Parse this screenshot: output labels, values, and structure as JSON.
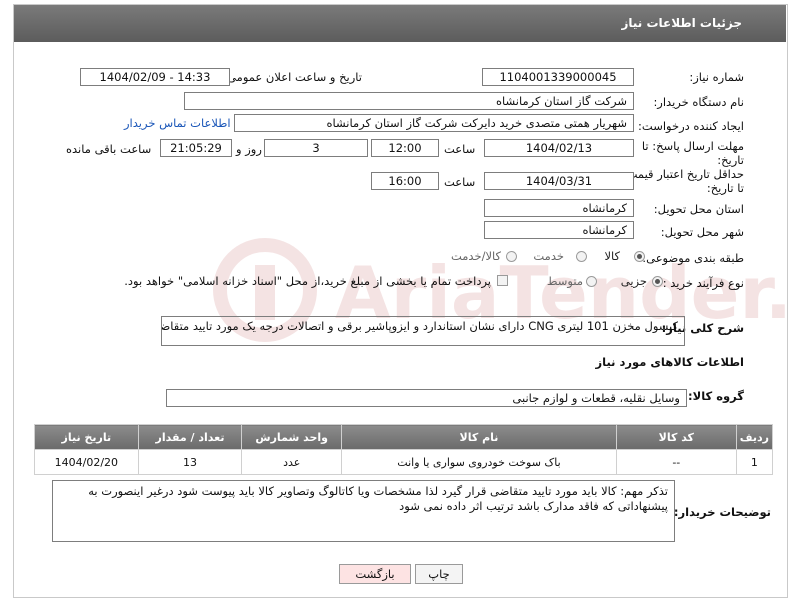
{
  "header": {
    "title": "جزئیات اطلاعات نیاز"
  },
  "fields": {
    "need_number_label": "شماره نیاز:",
    "need_number": "1104001339000045",
    "announce_label": "تاریخ و ساعت اعلان عمومی:",
    "announce_value": "1404/02/09 - 14:33",
    "buyer_org_label": "نام دستگاه خریدار:",
    "buyer_org": "شرکت گاز استان کرمانشاه",
    "creator_label": "ایجاد کننده درخواست:",
    "creator": "شهریار همتی متصدی خرید دایرکت شرکت گاز استان کرمانشاه",
    "contact_link": "اطلاعات تماس خریدار",
    "deadline_label_1": "مهلت ارسال پاسخ: تا",
    "deadline_label_2": "تاریخ:",
    "deadline_date": "1404/02/13",
    "time_label": "ساعت",
    "deadline_time": "12:00",
    "days_value": "3",
    "days_label": "روز و",
    "remaining_time": "21:05:29",
    "remaining_label": "ساعت باقی مانده",
    "validity_label_1": "حداقل تاریخ اعتبار قیمت:",
    "validity_label_2": "تا تاریخ:",
    "validity_date": "1404/03/31",
    "validity_time": "16:00",
    "province_label": "استان محل تحویل:",
    "province": "کرمانشاه",
    "city_label": "شهر محل تحویل:",
    "city": "کرمانشاه",
    "category_label": "طبقه بندی موضوعی:",
    "category_options": [
      "کالا",
      "خدمت",
      "کالا/خدمت"
    ],
    "process_label": "نوع فرآیند خرید :",
    "process_options": [
      "جزیی",
      "متوسط"
    ],
    "payment_note": "پرداخت تمام یا بخشی از مبلغ خرید،از محل \"اسناد خزانه اسلامی\" خواهد بود.",
    "description_label": "شرح کلی نیاز:",
    "description": "کپسول مخزن 101 لیتری CNG دارای نشان استاندارد و ایزوپاشیر برقی و اتصالات درجه یک مورد تایید متقاضی",
    "goods_info_title": "اطلاعات کالاهای مورد نیاز",
    "goods_group_label": "گروه کالا:",
    "goods_group": "وسایل نقلیه، قطعات و لوازم جانبی"
  },
  "table": {
    "headers": [
      "ردیف",
      "کد کالا",
      "نام کالا",
      "واحد شمارش",
      "تعداد / مقدار",
      "تاریخ نیاز"
    ],
    "rows": [
      [
        "1",
        "--",
        "باک سوخت خودروی سواری یا وانت",
        "عدد",
        "13",
        "1404/02/20"
      ]
    ]
  },
  "buyer_notes": {
    "label": "توضیحات خریدار:",
    "text": "تذکر مهم: کالا باید مورد تایید متقاضی قرار گیرد لذا مشخصات ویا کاتالوگ وتصاویر کالا باید پیوست شود درغیر اینصورت به پیشنهاداتی که فاقد مدارک باشد ترتیب اثر داده نمی شود"
  },
  "buttons": {
    "print": "چاپ",
    "back": "بازگشت"
  },
  "watermark": {
    "text": "AriaTender.net",
    "color": "#b03030"
  }
}
